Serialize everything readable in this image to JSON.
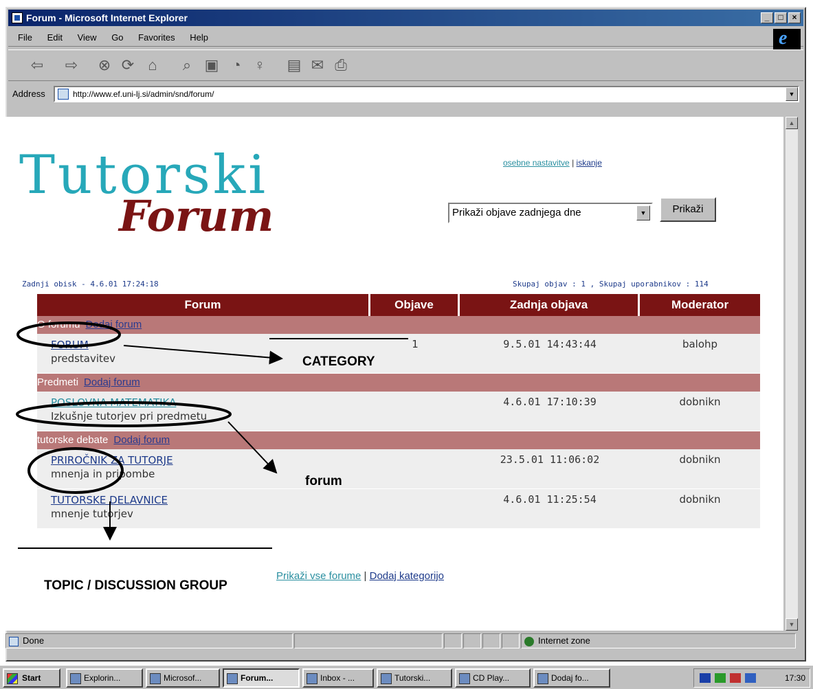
{
  "window": {
    "title": "Forum - Microsoft Internet Explorer"
  },
  "menu": [
    "File",
    "Edit",
    "View",
    "Go",
    "Favorites",
    "Help"
  ],
  "toolbar": {
    "icons": [
      "back-icon",
      "forward-icon",
      "stop-icon",
      "refresh-icon",
      "home-icon",
      "search-icon",
      "favorites-icon",
      "history-icon",
      "channels-icon",
      "fullscreen-icon",
      "mail-icon",
      "print-icon"
    ]
  },
  "address": {
    "label": "Address",
    "url": "http://www.ef.uni-lj.si/admin/snd/forum/"
  },
  "logo": {
    "line1": "Tutorski",
    "line2": "Forum"
  },
  "toplinks": {
    "settings": "osebne nastavitve",
    "sep": " | ",
    "search": "iskanje"
  },
  "filter": {
    "selected": "Prikaži objave zadnjega dne",
    "button": "Prikaži"
  },
  "info": {
    "last_visit": "Zadnji obisk - 4.6.01 17:24:18",
    "totals": "Skupaj objav : 1 , Skupaj uporabnikov : 114"
  },
  "table": {
    "headers": [
      "Forum",
      "Objave",
      "Zadnja objava",
      "Moderator"
    ],
    "categories": [
      {
        "name": "O forumu",
        "add_link": "Dodaj forum",
        "forums": [
          {
            "title": "FORUM",
            "desc": "predstavitev",
            "posts": "1",
            "last": "9.5.01 14:43:44",
            "moderator": "balohp"
          }
        ]
      },
      {
        "name": "Predmeti",
        "add_link": "Dodaj forum",
        "forums": [
          {
            "title": "POSLOVNA MATEMATIKA",
            "desc": "Izkušnje tutorjev pri predmetu",
            "posts": "",
            "last": "4.6.01 17:10:39",
            "moderator": "dobnikn"
          }
        ]
      },
      {
        "name": "tutorske debate",
        "add_link": "Dodaj forum",
        "forums": [
          {
            "title": "PRIROČNIK ZA TUTORJE",
            "desc": "mnenja in pripombe",
            "posts": "",
            "last": "23.5.01 11:06:02",
            "moderator": "dobnikn"
          },
          {
            "title": "TUTORSKE DELAVNICE",
            "desc": "mnenje tutorjev",
            "posts": "",
            "last": "4.6.01 11:25:54",
            "moderator": "dobnikn"
          }
        ]
      }
    ]
  },
  "bottomlinks": {
    "show_all": "Prikaži vse forume",
    "sep": " | ",
    "add_category": "Dodaj kategorijo"
  },
  "annotations": {
    "category": "CATEGORY",
    "forum": "forum",
    "topic": "TOPIC / DISCUSSION GROUP"
  },
  "status": {
    "text": "Done",
    "zone": "Internet zone"
  },
  "taskbar": {
    "start": "Start",
    "items": [
      "Explorin...",
      "Microsof...",
      "Forum...",
      "Inbox - ...",
      "Tutorski...",
      "CD Play...",
      "Dodaj fo..."
    ],
    "clock": "17:30"
  }
}
